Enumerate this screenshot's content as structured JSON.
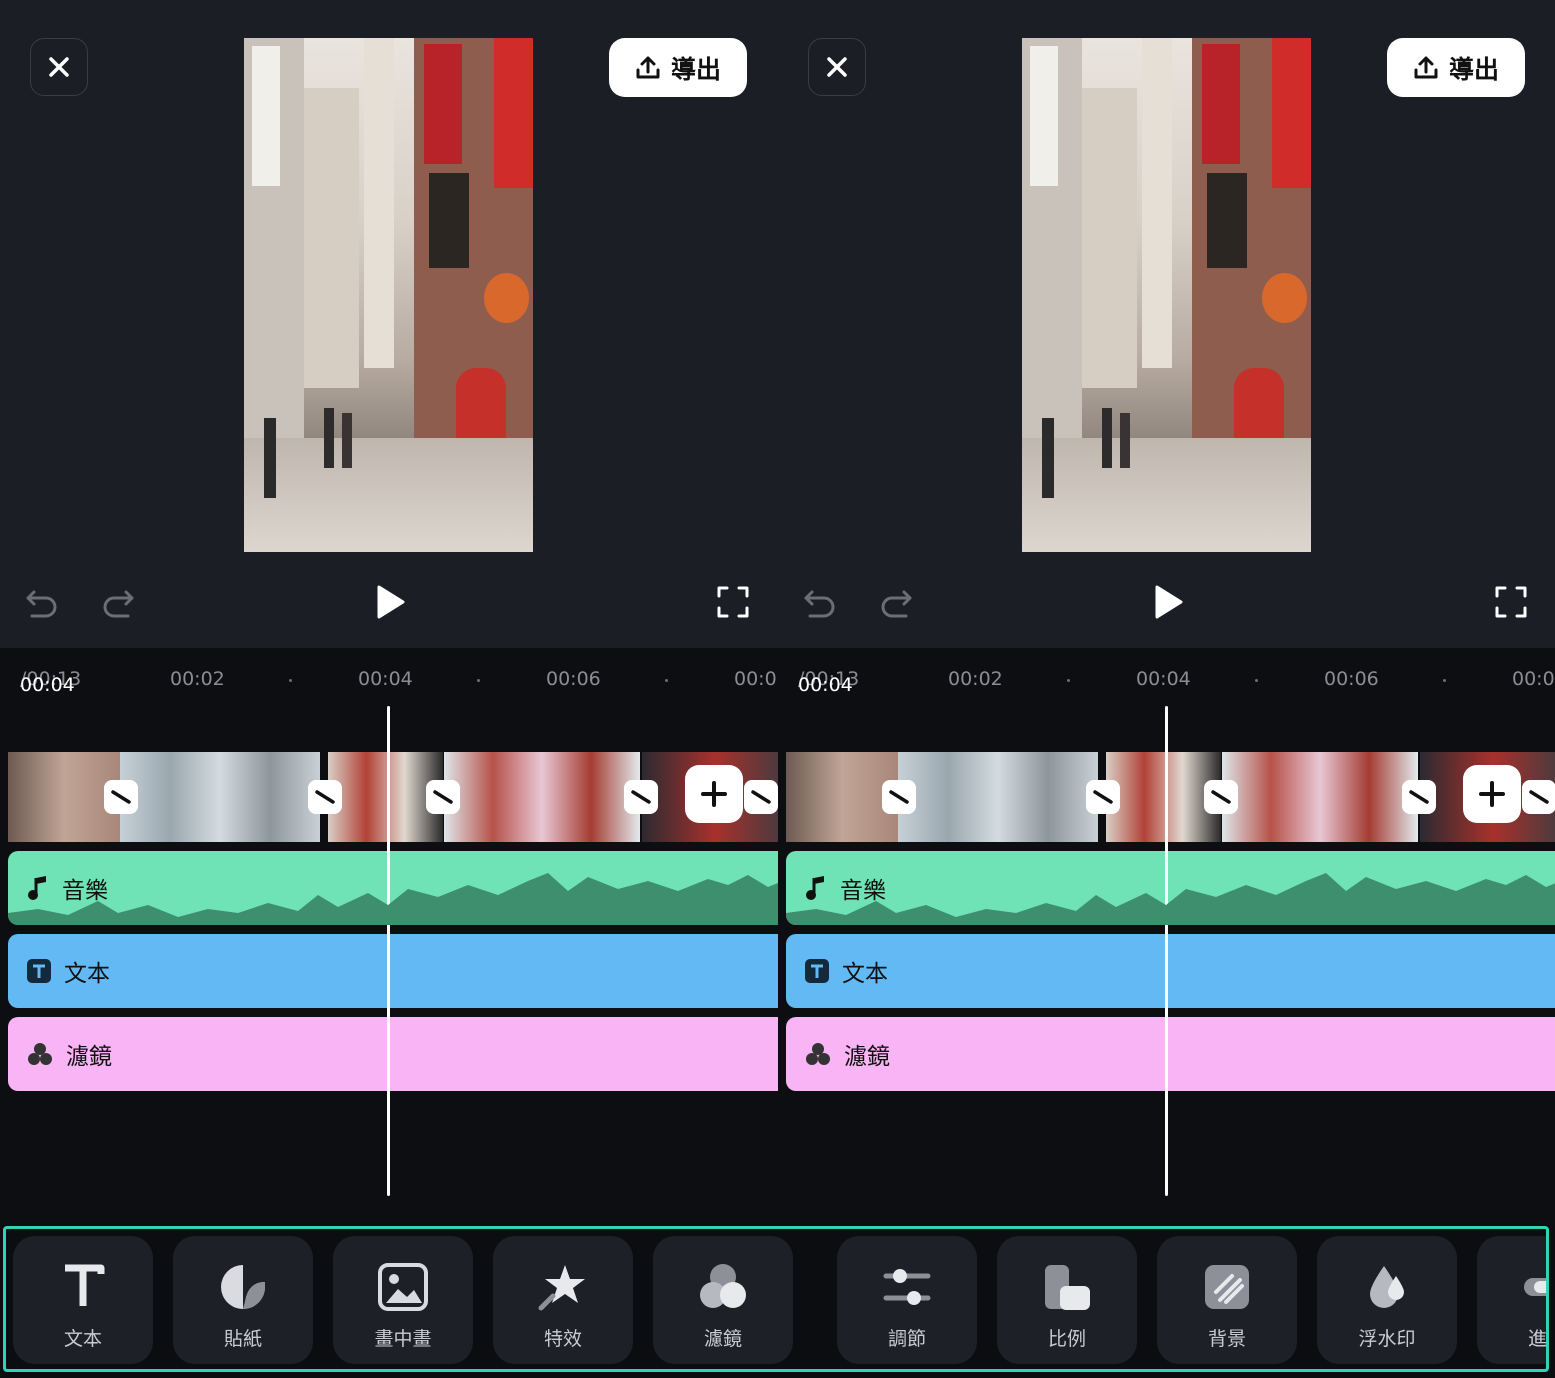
{
  "panels": [
    {
      "close_icon": "close-icon",
      "export_label": "導出",
      "time_current": "00:04",
      "time_total": "/00:13",
      "ruler": [
        "00:02",
        "00:04",
        "00:06",
        "00:0"
      ],
      "tracks": {
        "music": "音樂",
        "text": "文本",
        "filter": "濾鏡"
      }
    },
    {
      "close_icon": "close-icon",
      "export_label": "導出",
      "time_current": "00:04",
      "time_total": "/00:13",
      "ruler": [
        "00:02",
        "00:04",
        "00:06",
        "00:0"
      ],
      "tracks": {
        "music": "音樂",
        "text": "文本",
        "filter": "濾鏡"
      }
    }
  ],
  "toolbar": {
    "items": [
      {
        "label": "文本",
        "icon": "text-icon"
      },
      {
        "label": "貼紙",
        "icon": "sticker-icon"
      },
      {
        "label": "畫中畫",
        "icon": "picture-in-picture-icon"
      },
      {
        "label": "特效",
        "icon": "effects-icon"
      },
      {
        "label": "濾鏡",
        "icon": "filter-icon"
      },
      {
        "label": "調節",
        "icon": "adjust-icon"
      },
      {
        "label": "比例",
        "icon": "ratio-icon"
      },
      {
        "label": "背景",
        "icon": "background-icon"
      },
      {
        "label": "浮水印",
        "icon": "watermark-icon"
      },
      {
        "label": "進度",
        "icon": "progress-icon"
      }
    ],
    "highlight_color": "#2bd6b4"
  },
  "colors": {
    "music_track": "#6fe3b6",
    "text_track": "#63b9f4",
    "filter_track": "#f8b4f4"
  }
}
